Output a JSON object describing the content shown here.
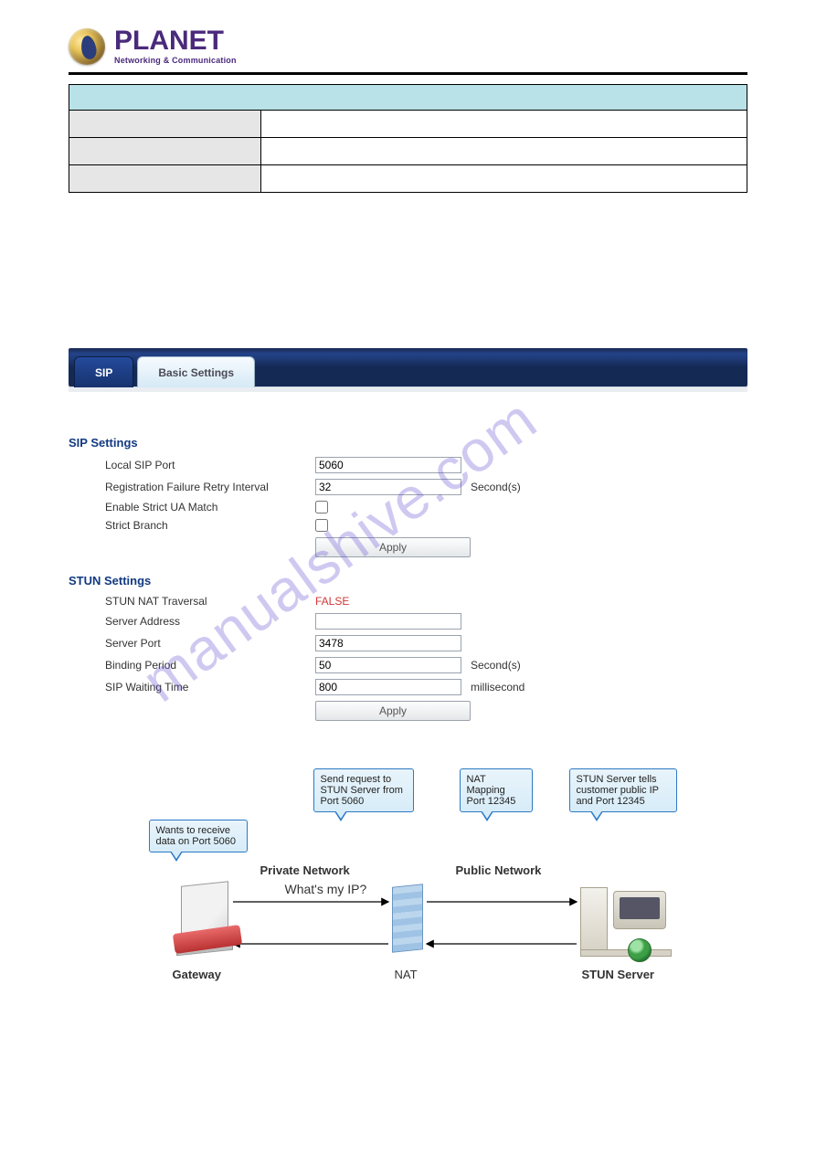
{
  "brand": {
    "name": "PLANET",
    "tagline": "Networking & Communication"
  },
  "ui": {
    "tabs": {
      "sip": "SIP",
      "basic": "Basic Settings"
    },
    "sip_settings": {
      "heading": "SIP Settings",
      "local_port_label": "Local SIP Port",
      "local_port_value": "5060",
      "retry_label": "Registration Failure Retry Interval",
      "retry_value": "32",
      "retry_unit": "Second(s)",
      "strict_ua_label": "Enable Strict UA Match",
      "strict_branch_label": "Strict Branch",
      "apply": "Apply"
    },
    "stun_settings": {
      "heading": "STUN Settings",
      "nat_label": "STUN NAT Traversal",
      "nat_value": "FALSE",
      "server_addr_label": "Server Address",
      "server_addr_value": "",
      "server_port_label": "Server Port",
      "server_port_value": "3478",
      "binding_label": "Binding Period",
      "binding_value": "50",
      "binding_unit": "Second(s)",
      "wait_label": "SIP Waiting Time",
      "wait_value": "800",
      "wait_unit": "millisecond",
      "apply": "Apply"
    }
  },
  "diagram": {
    "callouts": {
      "gw": "Wants to receive data on Port 5060",
      "send": "Send request to STUN Server from Port 5060",
      "nat": "NAT Mapping Port 12345",
      "srv": "STUN Server tells customer public IP and Port 12345"
    },
    "private_label": "Private Network",
    "public_label": "Public Network",
    "question": "What's my IP?",
    "gw_label": "Gateway",
    "nat_label": "NAT",
    "srv_label": "STUN Server"
  },
  "watermark": "manualshive.com"
}
